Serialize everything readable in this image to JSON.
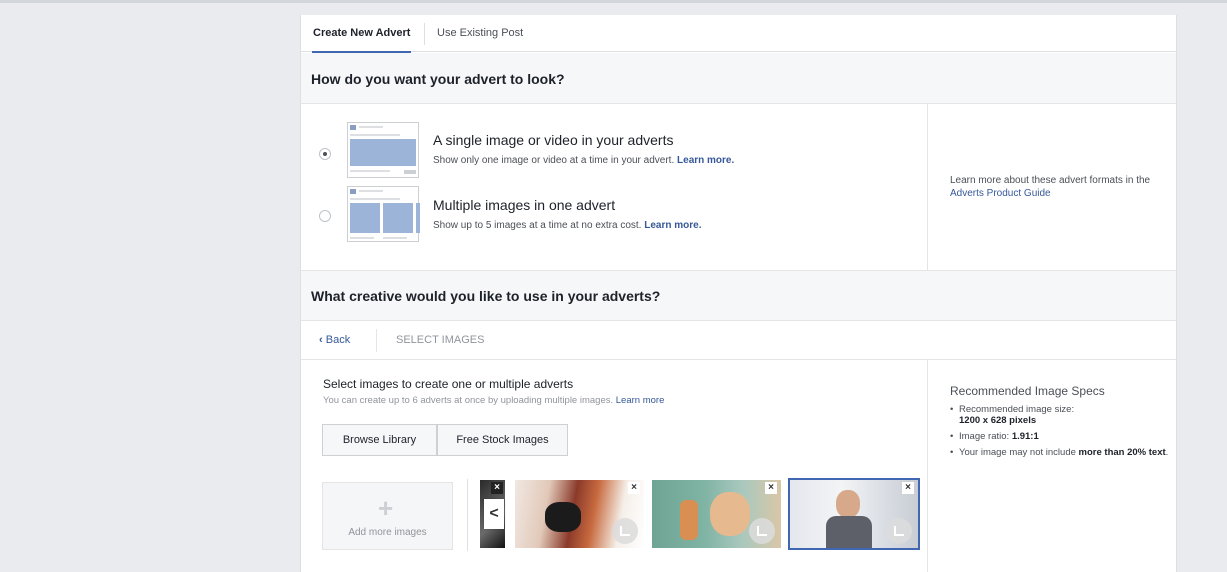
{
  "tabs": [
    {
      "label": "Create New Advert",
      "active": true
    },
    {
      "label": "Use Existing Post",
      "active": false
    }
  ],
  "format_section": {
    "heading": "How do you want your advert to look?",
    "options": [
      {
        "title": "A single image or video in your adverts",
        "desc": "Show only one image or video at a time in your advert.",
        "link": "Learn more.",
        "selected": true
      },
      {
        "title": "Multiple images in one advert",
        "desc": "Show up to 5 images at a time at no extra cost.",
        "link": "Learn more.",
        "selected": false
      }
    ],
    "guide_prefix": "Learn more about these advert formats in the",
    "guide_link": "Adverts Product Guide"
  },
  "creative_section": {
    "heading": "What creative would you like to use in your adverts?",
    "back_label": "Back",
    "step_label": "SELECT IMAGES",
    "select_title": "Select images to create one or multiple adverts",
    "select_desc": "You can create up to 6 adverts at once by uploading multiple images.",
    "select_link": "Learn more",
    "browse_label": "Browse Library",
    "stock_label": "Free Stock Images",
    "add_plus": "+",
    "add_label": "Add more images",
    "prev_glyph": "<",
    "close_glyph": "×"
  },
  "specs": {
    "title": "Recommended Image Specs",
    "size_label": "Recommended image size:",
    "size_value": "1200 x 628 pixels",
    "ratio_label": "Image ratio:",
    "ratio_value": "1.91:1",
    "text_prefix": "Your image may not include",
    "text_bold": "more than 20% text",
    "text_suffix": "."
  },
  "colors": {
    "accent": "#4267b2",
    "link": "#365899",
    "page_bg": "#e9ebee"
  }
}
